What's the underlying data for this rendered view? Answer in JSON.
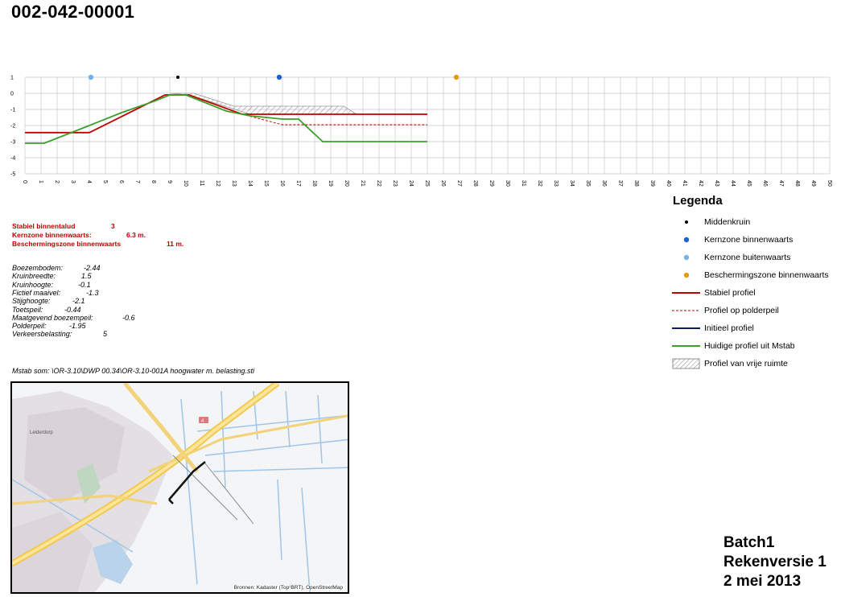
{
  "title": "002-042-00001",
  "chart_data": {
    "type": "line",
    "x_ticks": [
      "0",
      "1",
      "2",
      "3",
      "4",
      "5",
      "6",
      "7",
      "8",
      "9",
      "10",
      "11",
      "12",
      "13",
      "14",
      "15",
      "16",
      "17",
      "18",
      "19",
      "20",
      "21",
      "22",
      "23",
      "24",
      "25",
      "26",
      "27",
      "28",
      "29",
      "30",
      "31",
      "32",
      "33",
      "34",
      "35",
      "36",
      "37",
      "38",
      "39",
      "40",
      "41",
      "42",
      "43",
      "44",
      "45",
      "46",
      "47",
      "48",
      "49",
      "50"
    ],
    "y_ticks": [
      "1",
      "0",
      "-1",
      "-2",
      "-3",
      "-4",
      "-5"
    ],
    "xlim": [
      0,
      50
    ],
    "ylim": [
      -5,
      1
    ],
    "grid": true,
    "series": [
      {
        "name": "Stabiel profiel",
        "color": "#c00000",
        "style": "solid",
        "points": [
          [
            0,
            -2.44
          ],
          [
            4,
            -2.44
          ],
          [
            8.7,
            -0.1
          ],
          [
            10.2,
            -0.1
          ],
          [
            13.5,
            -1.3
          ],
          [
            25,
            -1.3
          ]
        ]
      },
      {
        "name": "Profiel op polderpeil",
        "color": "#c00000",
        "style": "dashed",
        "points": [
          [
            13.5,
            -1.3
          ],
          [
            16,
            -1.95
          ],
          [
            25,
            -1.95
          ]
        ]
      },
      {
        "name": "Huidige profiel uit Mstab",
        "color": "#3aa02a",
        "style": "solid",
        "points": [
          [
            0,
            -3.1
          ],
          [
            1.2,
            -3.1
          ],
          [
            4,
            -2.0
          ],
          [
            6,
            -1.2
          ],
          [
            8,
            -0.5
          ],
          [
            9,
            -0.1
          ],
          [
            10,
            -0.1
          ],
          [
            11,
            -0.5
          ],
          [
            12.5,
            -1.1
          ],
          [
            14,
            -1.4
          ],
          [
            16,
            -1.6
          ],
          [
            17,
            -1.6
          ],
          [
            18.5,
            -3.0
          ],
          [
            25,
            -3.0
          ]
        ]
      }
    ],
    "free_space_polygon": [
      [
        9,
        0
      ],
      [
        10.5,
        0
      ],
      [
        13,
        -0.8
      ],
      [
        19.8,
        -0.8
      ],
      [
        20.6,
        -1.3
      ],
      [
        14,
        -1.3
      ],
      [
        10.2,
        -0.1
      ]
    ],
    "markers": [
      {
        "name": "Middenkruin",
        "x": 9.5,
        "y": 1,
        "color": "#000000"
      },
      {
        "name": "Kernzone binnenwaarts",
        "x": 15.8,
        "y": 1,
        "color": "#1f5fcf"
      },
      {
        "name": "Kernzone buitenwaarts",
        "x": 4.1,
        "y": 1,
        "color": "#74b4ec"
      },
      {
        "name": "Beschermingszone binnenwaarts",
        "x": 26.8,
        "y": 1,
        "color": "#e39b11"
      }
    ]
  },
  "legend": {
    "title": "Legenda",
    "items": [
      {
        "label": "Middenkruin",
        "symbol": "dot",
        "color": "#000000"
      },
      {
        "label": "Kernzone binnenwaarts",
        "symbol": "dot",
        "color": "#1f5fcf"
      },
      {
        "label": "Kernzone buitenwaarts",
        "symbol": "dot",
        "color": "#74b4ec"
      },
      {
        "label": "Beschermingszone binnenwaarts",
        "symbol": "dot",
        "color": "#e39b11"
      },
      {
        "label": "Stabiel profiel",
        "symbol": "line",
        "color": "#c00000"
      },
      {
        "label": "Profiel op polderpeil",
        "symbol": "dashed-line",
        "color": "#c00000"
      },
      {
        "label": "Initieel profiel",
        "symbol": "line",
        "color": "#0a1a66"
      },
      {
        "label": "Huidige profiel uit Mstab",
        "symbol": "line",
        "color": "#3aa02a"
      },
      {
        "label": "Profiel van vrije ruimte",
        "symbol": "hatch-box",
        "color": "#888888"
      }
    ]
  },
  "summary": {
    "stabiel_label": "Stabiel binnentalud",
    "stabiel_value": "3",
    "kern_label": "Kernzone binnenwaarts:",
    "kern_value": "6.3 m.",
    "bescherm_label": "Beschermingszone binnenwaarts",
    "bescherm_value": "11 m."
  },
  "params": [
    {
      "label": "Boezembodem:",
      "value": "-2.44"
    },
    {
      "label": "Kruinbreedte:",
      "value": "1.5"
    },
    {
      "label": "Kruinhoogte:",
      "value": "-0.1"
    },
    {
      "label": "Fictief maaivel:",
      "value": "-1.3"
    },
    {
      "label": "Stijghoogte:",
      "value": "-2.1"
    },
    {
      "label": "Toetspeil:",
      "value": "-0.44"
    },
    {
      "label": "Maatgevend boezempeil:",
      "value": "-0.6"
    },
    {
      "label": "Polderpeil:",
      "value": "-1.95"
    },
    {
      "label": "Verkeersbelasting:",
      "value": "5"
    }
  ],
  "mstab_path": "Mstab som: \\OR-3.10\\DWP 00.34\\OR-3.10-001A hoogwater m. belasting.sti",
  "map": {
    "credit": "Bronnen: Kadaster (Top¹BRT), OpenStreetMap",
    "place_label": "Leiderdorp",
    "road_badge": "4"
  },
  "batch": {
    "line1": "Batch1",
    "line2": "Rekenversie 1",
    "line3": "2  mei 2013"
  }
}
